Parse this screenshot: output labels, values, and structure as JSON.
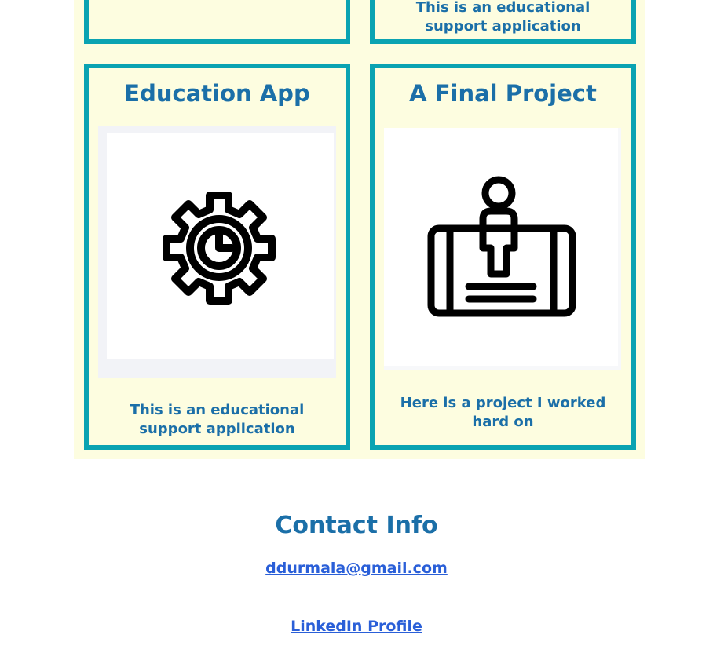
{
  "projects": [
    {
      "desc_partial": "application"
    },
    {
      "desc": "This is an educational support application"
    },
    {
      "title": "Education App",
      "image_icon": "gear-clock-icon",
      "desc": "This is an educational support application"
    },
    {
      "title": "A Final Project",
      "image_icon": "person-on-device-icon",
      "desc": "Here is a project I worked hard on"
    }
  ],
  "contact": {
    "title": "Contact Info",
    "email": "ddurmala@gmail.com",
    "linkedin": "LinkedIn Profile"
  },
  "colors": {
    "panel_background": "#fdfde0",
    "card_border": "#0aa3b2",
    "heading_text": "#1b6fa8",
    "link": "#2a5fd8"
  }
}
